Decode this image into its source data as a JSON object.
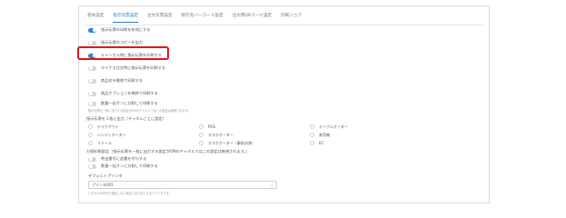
{
  "tabs": [
    "基本設定",
    "指示伝票設定",
    "注文伝票設定",
    "取引先バーコード設定",
    "注文用QRコード設定",
    "印刷ジョブ"
  ],
  "active_tab_index": 1,
  "settings": [
    {
      "label": "指示伝票の印刷を有効にする",
      "state": "on"
    },
    {
      "label": "指示伝票のコピーを出力",
      "state": "off"
    },
    {
      "label": "キャンセル時に指示伝票を印刷する",
      "state": "on"
    },
    {
      "label": "マイナス注文時に指示伝票を印刷する",
      "state": "off"
    },
    {
      "label": "商品名を略称で印刷する",
      "state": "off"
    },
    {
      "label": "商品オプションを略称で印刷する",
      "state": "off"
    },
    {
      "label": "数量一括オンに分割して印刷する",
      "state": "off"
    }
  ],
  "settings_note": "指示伝票を一枚に出力する設定がONのチャネルではこの設定は無視されます。",
  "channel_section_label": "指示伝票を１枚に出力（チャネルごとに設定）",
  "channels": [
    [
      "テイクアウト",
      "POS",
      "テーブルオーダー"
    ],
    [
      "ハンディオーダー",
      "スマホオーダー",
      "券売機"
    ],
    [
      "リテール",
      "スマホオーダー（事前決済）",
      "EC"
    ]
  ],
  "split_section_label": "分割印刷設定（指示伝票を一枚に出力する設定がONのチャネルではこの設定は無視されます。）",
  "split_settings": [
    {
      "label": "呼出番号に追番を付与する",
      "state": "off"
    },
    {
      "label": "数量一括オンに分割して印刷する",
      "state": "off"
    }
  ],
  "printer_label": "デフォルトプリンタ",
  "printer_value": "プリンタ001",
  "printer_note": "いずれの印字先も指定しない場合に出力先となるプリンタです。",
  "accent_color": "#2b86d9",
  "highlight_color": "#e0151b"
}
